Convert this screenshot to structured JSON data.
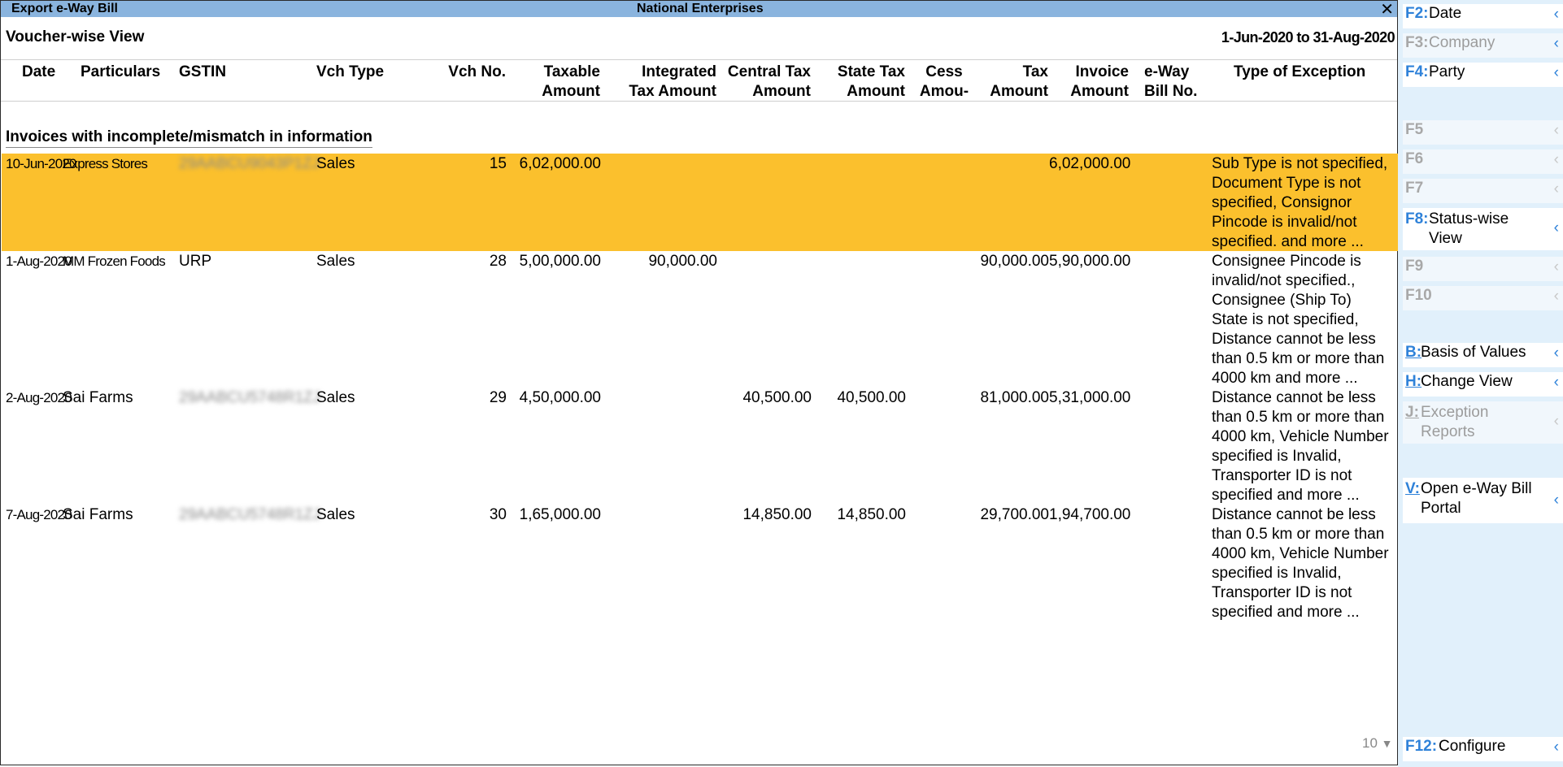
{
  "window": {
    "title": "Export e-Way Bill",
    "company": "National Enterprises",
    "close_icon": "close-icon"
  },
  "report": {
    "title": "Voucher-wise View",
    "period": "1-Jun-2020 to 31-Aug-2020",
    "section": "Invoices with incomplete/mismatch in information",
    "page_indicator": "10",
    "page_down_icon": "▼"
  },
  "columns": {
    "date": "Date",
    "particulars": "Particulars",
    "gstin": "GSTIN",
    "vch_type": "Vch Type",
    "vch_no": "Vch No.",
    "taxable": "Taxable\nAmount",
    "integrated": "Integrated\nTax Amount",
    "central": "Central Tax\nAmount",
    "state": "State Tax\nAmount",
    "cess": "Cess\nAmou-",
    "tax": "Tax\nAmount",
    "invoice": "Invoice\nAmount",
    "eway": "e-Way\nBill No.",
    "exception": "Type of Exception"
  },
  "rows": [
    {
      "date": "10-Jun-2020",
      "particulars": "Express Stores",
      "gstin": "29AABCU9043P1ZJ",
      "vch_type": "Sales",
      "vch_no": "15",
      "taxable": "6,02,000.00",
      "integrated": "",
      "central": "",
      "state": "",
      "cess": "",
      "tax": "",
      "invoice": "6,02,000.00",
      "eway": "",
      "exception": "Sub Type is not specified,\nDocument Type is not\nspecified, Consignor\nPincode is invalid/not\nspecified. and more ..."
    },
    {
      "date": "1-Aug-2020",
      "particulars": "MM Frozen Foods",
      "gstin": "URP",
      "vch_type": "Sales",
      "vch_no": "28",
      "taxable": "5,00,000.00",
      "integrated": "90,000.00",
      "central": "",
      "state": "",
      "cess": "",
      "tax": "90,000.00",
      "invoice": "5,90,000.00",
      "eway": "",
      "exception": "Consignee Pincode is\ninvalid/not specified.,\nConsignee (Ship To)\nState is not specified,\nDistance cannot be less\nthan 0.5 km or more than\n4000 km and more ..."
    },
    {
      "date": "2-Aug-2020",
      "particulars": "Sai Farms",
      "gstin": "29AABCU5748R1ZJ",
      "vch_type": "Sales",
      "vch_no": "29",
      "taxable": "4,50,000.00",
      "integrated": "",
      "central": "40,500.00",
      "state": "40,500.00",
      "cess": "",
      "tax": "81,000.00",
      "invoice": "5,31,000.00",
      "eway": "",
      "exception": "Distance cannot be less\nthan 0.5 km or more than\n4000 km, Vehicle Number\nspecified is Invalid,\nTransporter ID is not\nspecified and more ..."
    },
    {
      "date": "7-Aug-2020",
      "particulars": "Sai Farms",
      "gstin": "29AABCU5748R1ZJ",
      "vch_type": "Sales",
      "vch_no": "30",
      "taxable": "1,65,000.00",
      "integrated": "",
      "central": "14,850.00",
      "state": "14,850.00",
      "cess": "",
      "tax": "29,700.00",
      "invoice": "1,94,700.00",
      "eway": "",
      "exception": "Distance cannot be less\nthan 0.5 km or more than\n4000 km, Vehicle Number\nspecified is Invalid,\nTransporter ID is not\nspecified and more ..."
    }
  ],
  "sidebar": {
    "chevron_icon": "‹",
    "buttons": [
      {
        "key": "F2:",
        "label": "Date",
        "enabled": true
      },
      {
        "key": "F3:",
        "label": "Company",
        "enabled": false
      },
      {
        "key": "F4:",
        "label": "Party",
        "enabled": true
      },
      {
        "key": "F5",
        "label": "",
        "enabled": false
      },
      {
        "key": "F6",
        "label": "",
        "enabled": false
      },
      {
        "key": "F7",
        "label": "",
        "enabled": false
      },
      {
        "key": "F8:",
        "label": "Status-wise\nView",
        "enabled": true
      },
      {
        "key": "F9",
        "label": "",
        "enabled": false
      },
      {
        "key": "F10",
        "label": "",
        "enabled": false
      },
      {
        "key": "B:",
        "label": "Basis of Values",
        "enabled": true
      },
      {
        "key": "H:",
        "label": "Change View",
        "enabled": true
      },
      {
        "key": "J:",
        "label": "Exception\nReports",
        "enabled": false
      },
      {
        "key": "V:",
        "label": "Open e-Way Bill\nPortal",
        "enabled": true
      },
      {
        "key": "F12:",
        "label": "Configure",
        "enabled": true
      }
    ]
  },
  "colors": {
    "title_bar": "#8ab4de",
    "selected_row": "#fbc02d",
    "sidebar_bg": "#e1f0fb",
    "hotkey": "#2f82d9"
  }
}
